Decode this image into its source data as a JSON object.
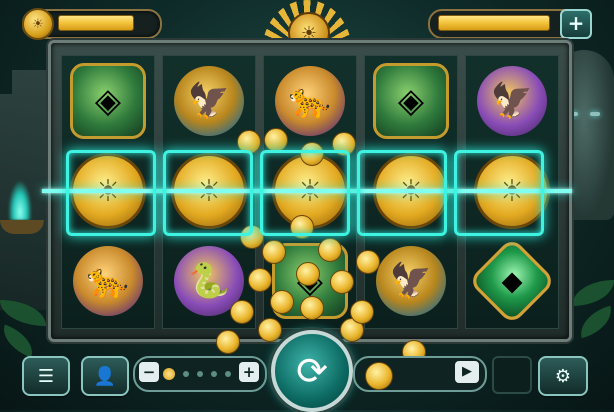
{
  "colors": {
    "accent_gold": "#f2c33a",
    "accent_teal": "#3ef3e1",
    "frame": "#6d7e79",
    "reel_bg": "#12302b"
  },
  "header": {
    "balance_icon": "sun-coin-icon",
    "emblem_icon": "sun-face-emblem-icon",
    "add_funds_label": "+",
    "balance_fill": 0.8,
    "win_fill": 0.9
  },
  "reels": [
    [
      "mask-icon",
      "sun-coin-icon",
      "jaguar-icon"
    ],
    [
      "eagle-icon",
      "sun-coin-icon",
      "serpent-icon"
    ],
    [
      "jaguar-icon",
      "sun-coin-icon",
      "idol-icon"
    ],
    [
      "mask-icon",
      "sun-coin-icon",
      "eagle-icon"
    ],
    [
      "purple-eagle-icon",
      "sun-coin-icon",
      "emerald-icon"
    ]
  ],
  "winning_row": 2,
  "controls": {
    "menu_icon": "menu-icon",
    "profile_icon": "user-icon",
    "bet_minus": "−",
    "bet_plus": "+",
    "spin_icon": "spin-icon",
    "play_icon": "play-icon",
    "settings_icon": "gear-icon"
  }
}
